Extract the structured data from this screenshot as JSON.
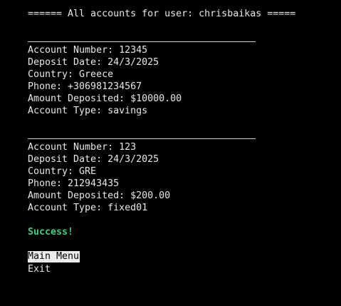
{
  "header": {
    "text": "====== All accounts for user: chrisbaikas ====="
  },
  "accounts": [
    {
      "account_number": "Account Number: 12345",
      "deposit_date": "Deposit Date: 24/3/2025",
      "country": "Country: Greece",
      "phone": "Phone: +306981234567",
      "amount": "Amount Deposited: $10000.00",
      "type": "Account Type: savings"
    },
    {
      "account_number": "Account Number: 123",
      "deposit_date": "Deposit Date: 24/3/2025",
      "country": "Country: GRE",
      "phone": "Phone: 212943435",
      "amount": "Amount Deposited: $200.00",
      "type": "Account Type: fixed01"
    }
  ],
  "status": {
    "message": "Success!",
    "color": "#3ecf7a"
  },
  "menu": {
    "items": [
      {
        "label": "Main Menu",
        "selected": true
      },
      {
        "label": "Exit",
        "selected": false
      }
    ]
  },
  "colors": {
    "background": "#000000",
    "foreground": "#e8e8e8",
    "selection_bg": "#ececec",
    "selection_fg": "#000000"
  }
}
